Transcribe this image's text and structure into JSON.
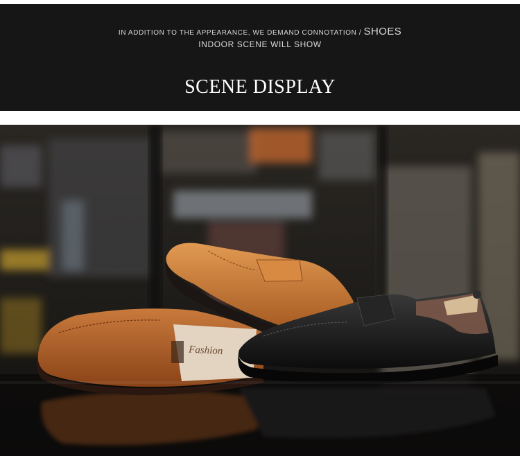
{
  "header": {
    "line1_prefix": "IN ADDITION TO THE APPEARANCE, WE DEMAND CONNOTATION / ",
    "line1_emphasis": "SHOES",
    "line2": "INDOOR SCENE WILL SHOW",
    "title": "SCENE DISPLAY"
  },
  "photo": {
    "insole_text": "Fashion"
  },
  "colors": {
    "banner_bg": "#161616",
    "tan_leather": "#c87a3a",
    "black_leather": "#1a1a1a"
  }
}
